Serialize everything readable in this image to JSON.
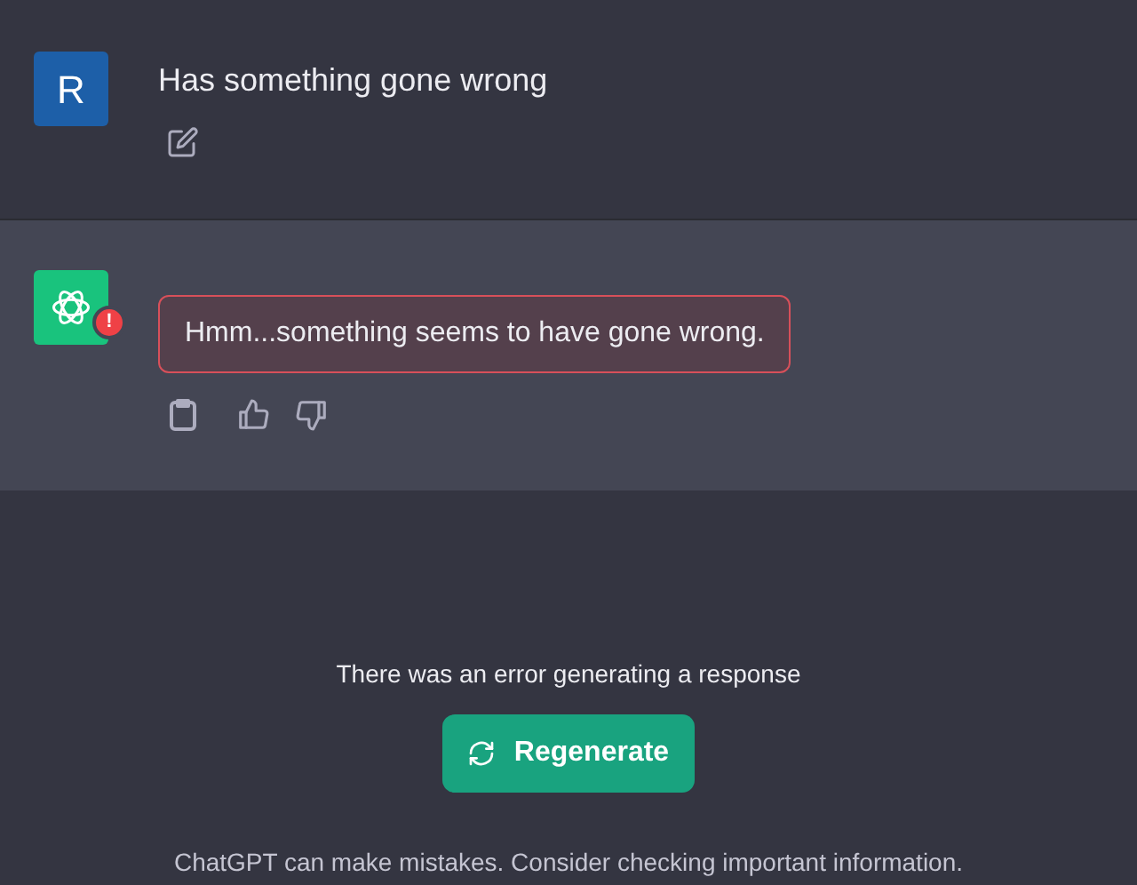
{
  "messages": [
    {
      "kind": "user",
      "avatar": "R",
      "text": "Has something gone wrong"
    },
    {
      "kind": "assistant",
      "error": true,
      "badge": "!",
      "text": "Hmm...something seems to have gone wrong."
    }
  ],
  "error_notice": "There was an error generating a response",
  "regenerate_button": "Regenerate",
  "footer": "ChatGPT can make mistakes. Consider checking important information."
}
